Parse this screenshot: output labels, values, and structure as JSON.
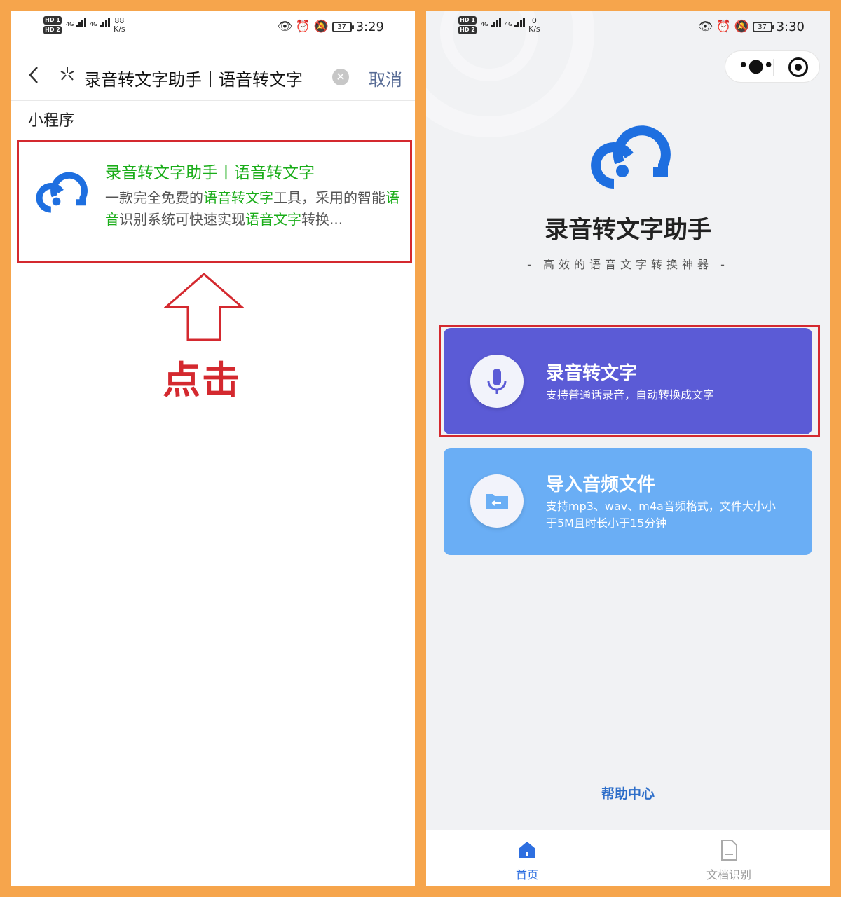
{
  "left_screen": {
    "status_bar": {
      "hd_labels": [
        "HD 1",
        "HD 2"
      ],
      "network": [
        "4G",
        "4G"
      ],
      "speed_value": "88",
      "speed_unit": "K/s",
      "battery": "37",
      "time": "3:29"
    },
    "search_bar": {
      "query": "录音转文字助手丨语音转文字",
      "cancel_label": "取消"
    },
    "section_label": "小程序",
    "result": {
      "title": "录音转文字助手丨语音转文字",
      "desc_parts": [
        "一款完全免费的",
        "语音转文字",
        "工具，采用的智能",
        "语音",
        "识别系统可快速实现",
        "语音文字",
        "转换..."
      ]
    },
    "annotation": {
      "label": "点击",
      "color": "#d4292f"
    }
  },
  "right_screen": {
    "status_bar": {
      "hd_labels": [
        "HD 1",
        "HD 2"
      ],
      "network": [
        "4G",
        "4G"
      ],
      "speed_value": "0",
      "speed_unit": "K/s",
      "battery": "37",
      "time": "3:30"
    },
    "app": {
      "title": "录音转文字助手",
      "subtitle": "- 高效的语音文字转换神器 -"
    },
    "features": [
      {
        "title": "录音转文字",
        "desc": "支持普通话录音，自动转换成文字",
        "icon": "microphone-icon",
        "color": "#5b5bd6"
      },
      {
        "title": "导入音频文件",
        "desc": "支持mp3、wav、m4a音频格式，文件大小小于5M且时长小于15分钟",
        "icon": "folder-icon",
        "color": "#6aaef5"
      }
    ],
    "help_link": "帮助中心",
    "tabs": [
      {
        "label": "首页",
        "icon": "home-icon",
        "active": true
      },
      {
        "label": "文档识别",
        "icon": "document-icon",
        "active": false
      }
    ]
  },
  "colors": {
    "background": "#f6a54c",
    "highlight_red": "#d4292f",
    "wechat_green": "#1aad19",
    "logo_blue": "#1e6fe0"
  }
}
